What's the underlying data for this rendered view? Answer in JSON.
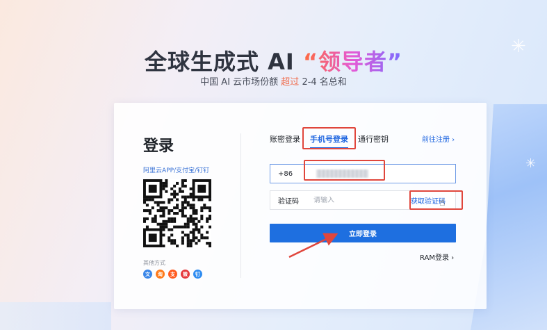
{
  "headline": {
    "main": "全球生成式 AI ",
    "accent": "“领导者”"
  },
  "subline": {
    "prefix": "中国 AI 云市场份额 ",
    "accent": "超过",
    "suffix": " 2-4 名总和"
  },
  "login": {
    "title": "登录",
    "app_hint": "阿里云APP/支付宝/钉钉",
    "other_label": "其他方式",
    "socials": [
      {
        "icon": "wen-icon",
        "glyph": "文",
        "color": "#3a86e8"
      },
      {
        "icon": "taobao-icon",
        "glyph": "淘",
        "color": "#ff7a1a"
      },
      {
        "icon": "alipay-icon",
        "glyph": "支",
        "color": "#ff5a1f"
      },
      {
        "icon": "weibo-icon",
        "glyph": "微",
        "color": "#e5383b"
      },
      {
        "icon": "dingtalk-icon",
        "glyph": "钉",
        "color": "#2f8cf0"
      }
    ]
  },
  "tabs": [
    {
      "label": "账密登录",
      "active": false
    },
    {
      "label": "手机号登录",
      "active": true
    },
    {
      "label": "通行密钥",
      "active": false
    }
  ],
  "register_link": "前往注册 ›",
  "phone": {
    "prefix": "+86"
  },
  "code": {
    "label": "验证码",
    "placeholder": "请输入",
    "get_code": "获取验证码"
  },
  "submit_label": "立即登录",
  "ram_link": "RAM登录 ›",
  "colors": {
    "primary": "#1e6fe0",
    "annotation_red": "#e0463c"
  }
}
